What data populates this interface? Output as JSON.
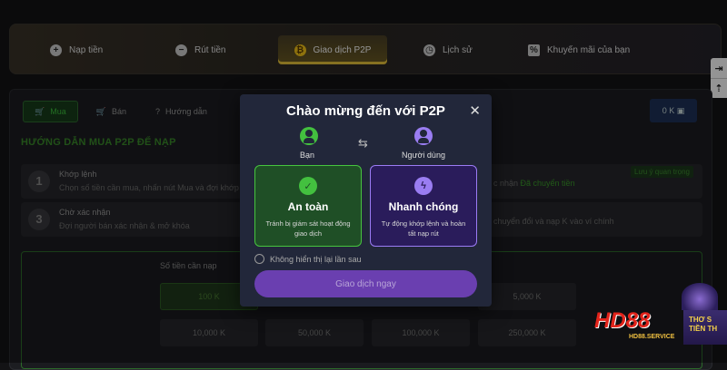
{
  "tabs": [
    {
      "label": "Nạp tiền",
      "icon": "plus-icon"
    },
    {
      "label": "Rút tiền",
      "icon": "minus-icon"
    },
    {
      "label": "Giao dịch P2P",
      "icon": "p2p-coin-icon",
      "active": true
    },
    {
      "label": "Lịch sử",
      "icon": "clock-icon"
    },
    {
      "label": "Khuyến mãi của bạn",
      "icon": "percent-icon"
    }
  ],
  "side_icons": [
    "login-icon",
    "arrow-up-icon"
  ],
  "subtabs": [
    {
      "label": "Mua",
      "active": true
    },
    {
      "label": "Bán"
    },
    {
      "label": "Hướng dẫn"
    }
  ],
  "balance": "0 K",
  "guide": {
    "title": "HƯỚNG DẪN MUA P2P ĐỂ NẠP",
    "steps": [
      {
        "num": "1",
        "title": "Khớp lệnh",
        "desc": "Chọn số tiền cần mua, nhấn nút Mua và đợi khớp",
        "right": "c nhận ",
        "right_hl": "Đã chuyển tiền",
        "note": "Lưu ý quan trọng"
      },
      {
        "num": "3",
        "title": "Chờ xác nhận",
        "desc": "Đợi người bán xác nhận & mở khóa",
        "right": "chuyển đổi và nạp K vào ví chính"
      }
    ]
  },
  "form": {
    "label": "Số tiền cần nạp",
    "amounts": [
      "100 K",
      "5,000 K",
      "10,000 K",
      "50,000 K",
      "100,000 K",
      "250,000 K"
    ]
  },
  "modal": {
    "title": "Chào mừng đến với P2P",
    "user_left": "Bạn",
    "user_right": "Người dùng",
    "swap": "⇆",
    "card_safe": {
      "title": "An toàn",
      "desc": "Tránh bị giám sát hoạt động giao dịch"
    },
    "card_fast": {
      "title": "Nhanh chóng",
      "desc": "Tự động khớp lệnh và hoàn tất nạp rút"
    },
    "checkbox": "Không hiển thị lại lần sau",
    "button": "Giao dịch ngay"
  },
  "brand": {
    "logo": "HD88",
    "subtitle": "HD88.SERVICE",
    "promo": "THƠ S TIỀN TH"
  },
  "colors": {
    "accent_gold": "#e7c33a",
    "green": "#43c03f",
    "purple": "#9a7df2",
    "button": "#6a3fb0"
  }
}
